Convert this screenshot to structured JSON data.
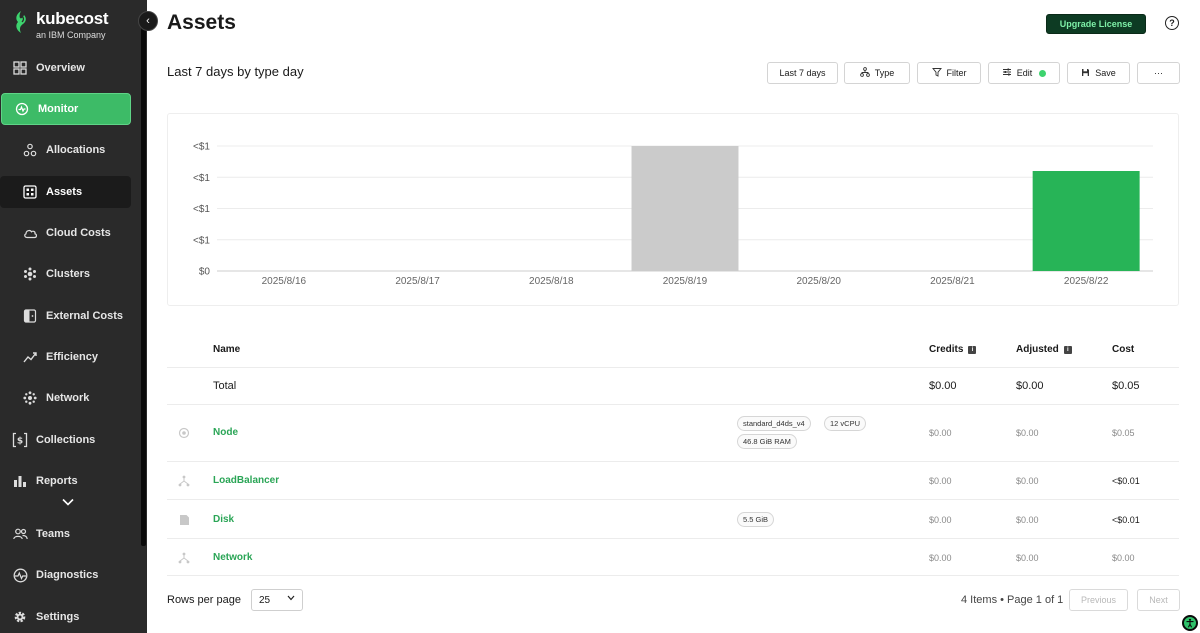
{
  "brand": {
    "name": "kubecost",
    "tagline": "an IBM Company"
  },
  "sidebar": {
    "items": [
      {
        "label": "Overview",
        "icon": "grid-icon"
      },
      {
        "label": "Monitor",
        "icon": "monitor-icon"
      },
      {
        "label": "Allocations",
        "icon": "allocations-icon"
      },
      {
        "label": "Assets",
        "icon": "assets-icon"
      },
      {
        "label": "Cloud Costs",
        "icon": "cloud-icon"
      },
      {
        "label": "Clusters",
        "icon": "clusters-icon"
      },
      {
        "label": "External Costs",
        "icon": "external-costs-icon"
      },
      {
        "label": "Efficiency",
        "icon": "efficiency-icon"
      },
      {
        "label": "Network",
        "icon": "network-icon"
      },
      {
        "label": "Collections",
        "icon": "collections-icon"
      },
      {
        "label": "Reports",
        "icon": "reports-icon"
      },
      {
        "label": "Teams",
        "icon": "teams-icon"
      },
      {
        "label": "Diagnostics",
        "icon": "diagnostics-icon"
      },
      {
        "label": "Settings",
        "icon": "settings-icon"
      }
    ]
  },
  "header": {
    "title": "Assets",
    "upgrade_label": "Upgrade License",
    "help_glyph": "?"
  },
  "report": {
    "title": "Last 7 days by type day"
  },
  "toolbar": {
    "range_label": "Last 7 days",
    "type_label": "Type",
    "filter_label": "Filter",
    "edit_label": "Edit",
    "save_label": "Save",
    "more_label": "···"
  },
  "colors": {
    "accent": "#3dbb67",
    "bar_gray": "#cbcbcb",
    "bar_green": "#27b457"
  },
  "chart_data": {
    "type": "bar",
    "categories": [
      "2025/8/16",
      "2025/8/17",
      "2025/8/18",
      "2025/8/19",
      "2025/8/20",
      "2025/8/21",
      "2025/8/22"
    ],
    "y_tick_labels": [
      "$0",
      "<$1",
      "<$1",
      "<$1",
      "<$1"
    ],
    "series": [
      {
        "color": "#cbcbcb",
        "values": [
          0,
          0,
          0,
          0.05,
          0,
          0,
          0
        ]
      },
      {
        "color": "#27b457",
        "values": [
          0,
          0,
          0,
          0,
          0,
          0,
          0.04
        ]
      }
    ],
    "ylim": [
      0,
      0.05
    ],
    "grid": true,
    "xlabel": "",
    "ylabel": ""
  },
  "table": {
    "headers": {
      "name": "Name",
      "credits": "Credits",
      "adjusted": "Adjusted",
      "cost": "Cost"
    },
    "total": {
      "label": "Total",
      "credits": "$0.00",
      "adjusted": "$0.00",
      "cost": "$0.05"
    },
    "rows": [
      {
        "name": "Node",
        "icon": "node-icon",
        "tags": [
          "standard_d4ds_v4",
          "12 vCPU",
          "46.8 GiB RAM"
        ],
        "credits": "$0.00",
        "adjusted": "$0.00",
        "cost": "$0.05"
      },
      {
        "name": "LoadBalancer",
        "icon": "loadbalancer-icon",
        "tags": [],
        "credits": "$0.00",
        "adjusted": "$0.00",
        "cost": "<$0.01"
      },
      {
        "name": "Disk",
        "icon": "disk-icon",
        "tags": [
          "5.5 GiB"
        ],
        "credits": "$0.00",
        "adjusted": "$0.00",
        "cost": "<$0.01"
      },
      {
        "name": "Network",
        "icon": "network-icon",
        "tags": [],
        "credits": "$0.00",
        "adjusted": "$0.00",
        "cost": "$0.00"
      }
    ]
  },
  "pagination": {
    "rows_label": "Rows per page",
    "rows_value": "25",
    "info": "4 Items • Page 1 of 1",
    "previous_label": "Previous",
    "next_label": "Next"
  }
}
